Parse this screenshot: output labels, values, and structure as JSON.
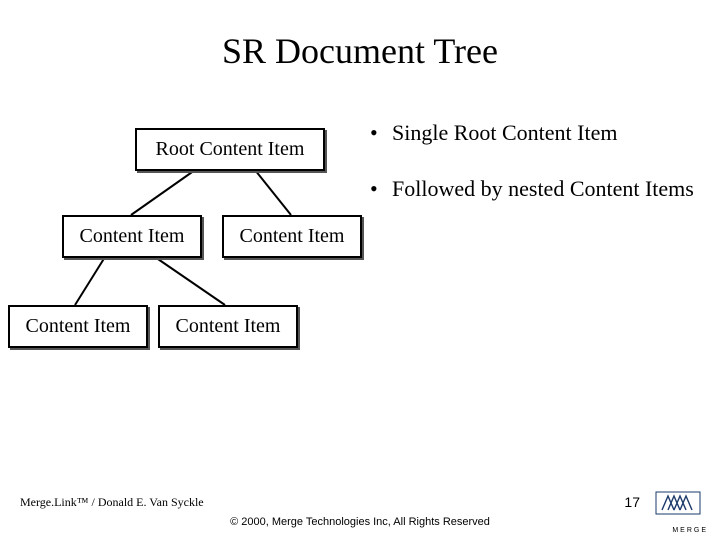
{
  "title": "SR Document Tree",
  "tree": {
    "root": "Root Content Item",
    "level1_left": "Content Item",
    "level1_right": "Content Item",
    "level2_left": "Content Item",
    "level2_right": "Content Item"
  },
  "bullets": [
    "Single Root Content Item",
    "Followed by nested Content Items"
  ],
  "footer": {
    "author": "Merge.Link™ / Donald E. Van Syckle",
    "copyright": "© 2000, Merge Technologies Inc, All Rights Reserved",
    "page": "17",
    "logo_text": "MERGE"
  }
}
